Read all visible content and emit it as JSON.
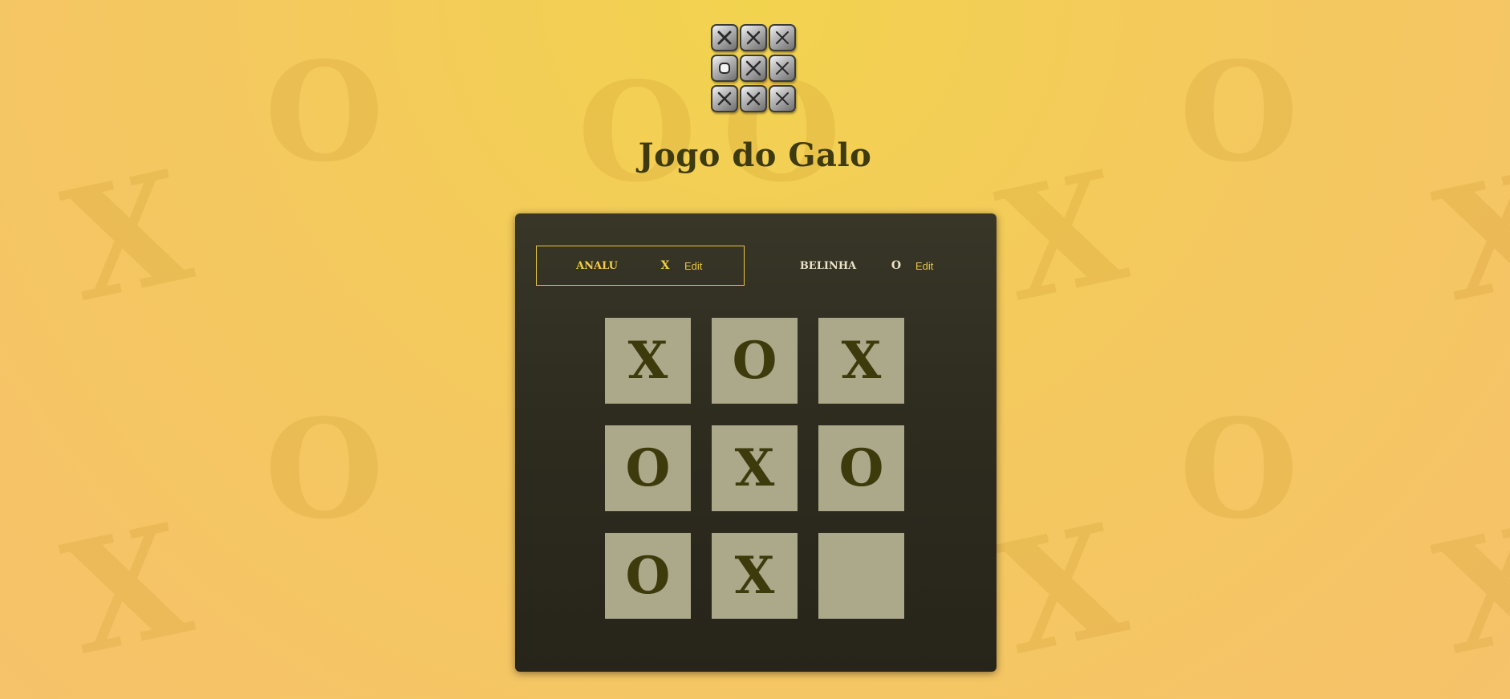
{
  "app": {
    "title": "Jogo do Galo"
  },
  "logo": {
    "tiles": [
      "x-icon",
      "x-icon",
      "x-icon",
      "o-icon",
      "x-icon",
      "x-icon",
      "x-icon",
      "x-icon",
      "x-icon"
    ]
  },
  "background": {
    "marks": [
      "O",
      "X",
      "O",
      "X",
      "O",
      "X",
      "O",
      "X",
      "O",
      "X",
      "O",
      "X"
    ]
  },
  "players": [
    {
      "name": "Analu",
      "symbol": "X",
      "edit_label": "Edit",
      "active": true
    },
    {
      "name": "Belinha",
      "symbol": "O",
      "edit_label": "Edit",
      "active": false
    }
  ],
  "board": {
    "cells": [
      "X",
      "O",
      "X",
      "O",
      "X",
      "O",
      "O",
      "X",
      ""
    ]
  },
  "colors": {
    "accent": "#e8c840",
    "panel": "#2e2c1f",
    "cell": "#aca88a",
    "symbol": "#3d3a0c",
    "title": "#3e3a10"
  }
}
